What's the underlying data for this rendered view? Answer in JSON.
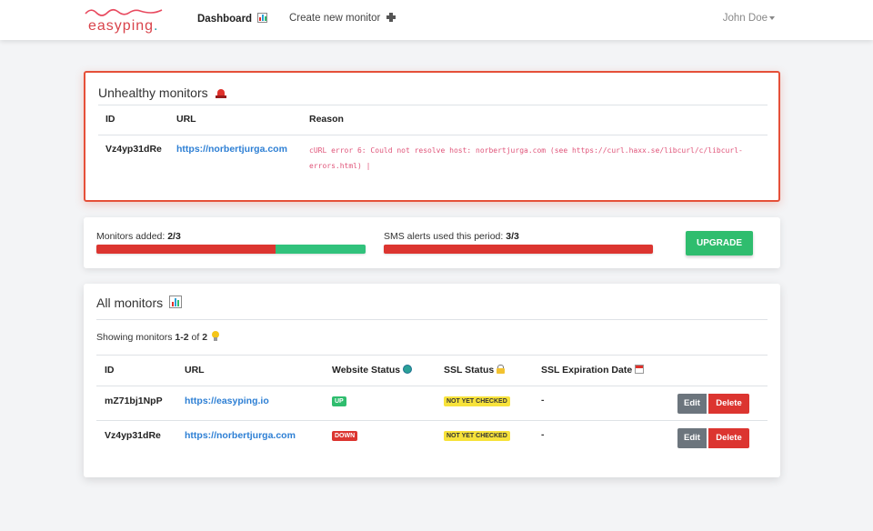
{
  "nav": {
    "logo_text": "easyping",
    "logo_dot": ".",
    "dashboard_label": "Dashboard",
    "create_label": "Create new monitor",
    "user_name": "John Doe"
  },
  "unhealthy": {
    "title": "Unhealthy monitors",
    "headers": {
      "id": "ID",
      "url": "URL",
      "reason": "Reason"
    },
    "rows": [
      {
        "id": "Vz4yp31dRe",
        "url": "https://norbertjurga.com",
        "reason_line1": "cURL error 6: Could not resolve host: norbertjurga.com (see https://curl.haxx.se/libcurl/c/libcurl-",
        "reason_line2": "errors.html) |"
      }
    ]
  },
  "usage": {
    "monitors_label": "Monitors added:",
    "monitors_value": "2/3",
    "monitors_fraction": 0.667,
    "sms_label": "SMS alerts used this period:",
    "sms_value": "3/3",
    "sms_fraction": 1.0,
    "upgrade_label": "UPGRADE",
    "colors": {
      "used": "#dc3530",
      "free": "#31c27c"
    }
  },
  "all": {
    "title": "All monitors",
    "showing_prefix": "Showing monitors",
    "showing_range": "1-2",
    "showing_of": "of",
    "showing_total": "2",
    "headers": {
      "id": "ID",
      "url": "URL",
      "website_status": "Website Status",
      "ssl_status": "SSL Status",
      "ssl_expiration": "SSL Expiration Date"
    },
    "rows": [
      {
        "id": "mZ71bj1NpP",
        "url": "https://easyping.io",
        "status": "UP",
        "ssl": "NOT YET CHECKED",
        "expiration": "-",
        "edit": "Edit",
        "delete": "Delete"
      },
      {
        "id": "Vz4yp31dRe",
        "url": "https://norbertjurga.com",
        "status": "DOWN",
        "ssl": "NOT YET CHECKED",
        "expiration": "-",
        "edit": "Edit",
        "delete": "Delete"
      }
    ]
  }
}
